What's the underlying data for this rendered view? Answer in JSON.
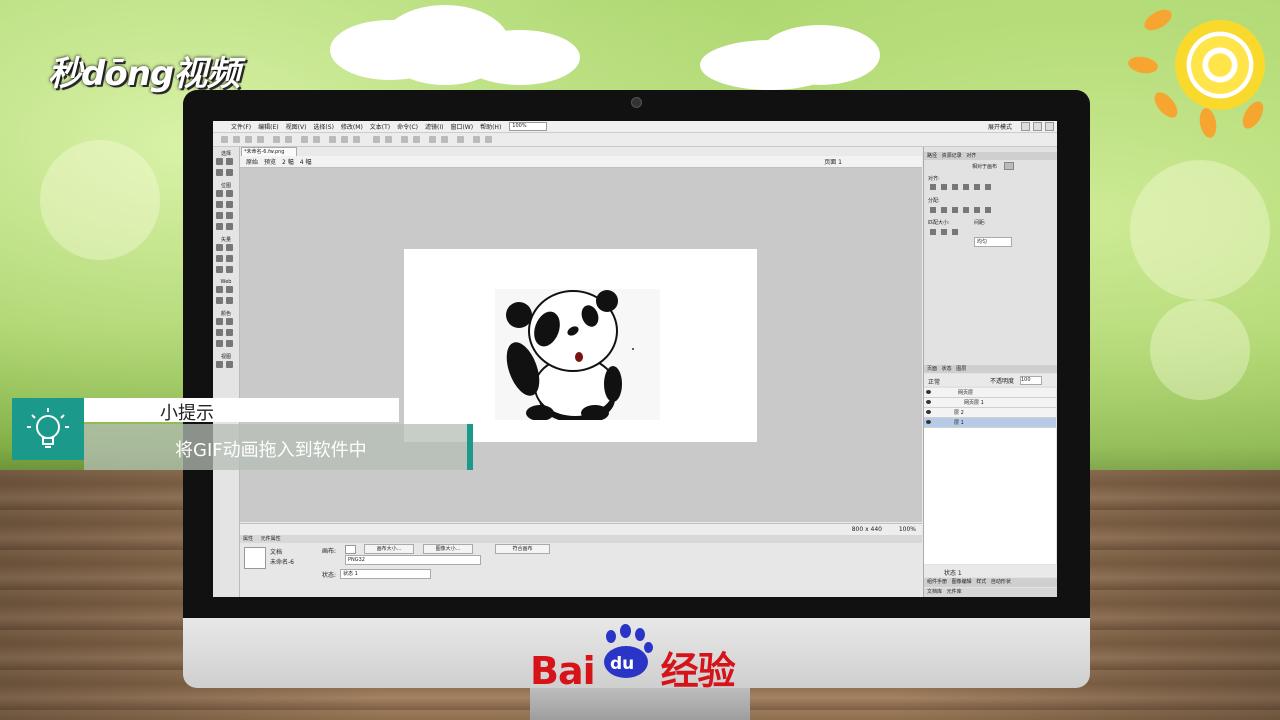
{
  "watermark": {
    "brand": "秒dōng视频"
  },
  "app": {
    "menus": [
      "文件(F)",
      "编辑(E)",
      "视图(V)",
      "选择(S)",
      "修改(M)",
      "文本(T)",
      "命令(C)",
      "滤镜(I)",
      "窗口(W)",
      "帮助(H)"
    ],
    "zoom": "100%",
    "expand_mode": "展开模式",
    "doc_tab": "*未命名-6.fw.png",
    "views": [
      "原始",
      "预览",
      "2 幅",
      "4 幅"
    ],
    "page_label": "页面 1",
    "tools_sections": [
      "选择",
      "位图",
      "矢量",
      "Web",
      "颜色",
      "视图"
    ],
    "status_size": "800 x 440",
    "status_zoom": "100%",
    "props_tabs": [
      "属性",
      "元件属性"
    ],
    "props": {
      "doc_label": "文档",
      "doc_name": "未命名-6",
      "canvas_label": "画布:",
      "canvas_size_btn": "画布大小...",
      "image_size_btn": "图像大小...",
      "fit_canvas_btn": "符合画布",
      "format": "PNG32",
      "state_label": "状态:",
      "state_value": "状态 1"
    },
    "right_panel": {
      "tabs": [
        "路径",
        "资源记录",
        "对齐"
      ],
      "relative_to": "相对于画布",
      "align_label": "对齐:",
      "distribute_label": "分配:",
      "match_size_label": "匹配大小:",
      "spacing_label": "间距:",
      "spacing_mode": "均匀",
      "layer_tabs": [
        "页面",
        "状态",
        "图层"
      ],
      "blend_mode": "正常",
      "opacity_label": "不透明度",
      "opacity_value": "100",
      "layers": [
        "网页层",
        "网页层 1",
        "层 2",
        "层 1"
      ],
      "state_footer": "状态 1",
      "bottom_tabs": [
        "组件手册",
        "图像编辑",
        "样式",
        "自动形状"
      ],
      "bottom_tabs2": [
        "文档库",
        "元件库"
      ]
    }
  },
  "tip": {
    "title": "小提示",
    "body": "将GIF动画拖入到软件中"
  },
  "footer_brand": {
    "text_left": "Bai",
    "paw_text": "du",
    "text_right": "经验"
  },
  "colors": {
    "teal": "#1b9a8c",
    "baidu_red": "#d7131a",
    "baidu_blue": "#2a35c8"
  }
}
